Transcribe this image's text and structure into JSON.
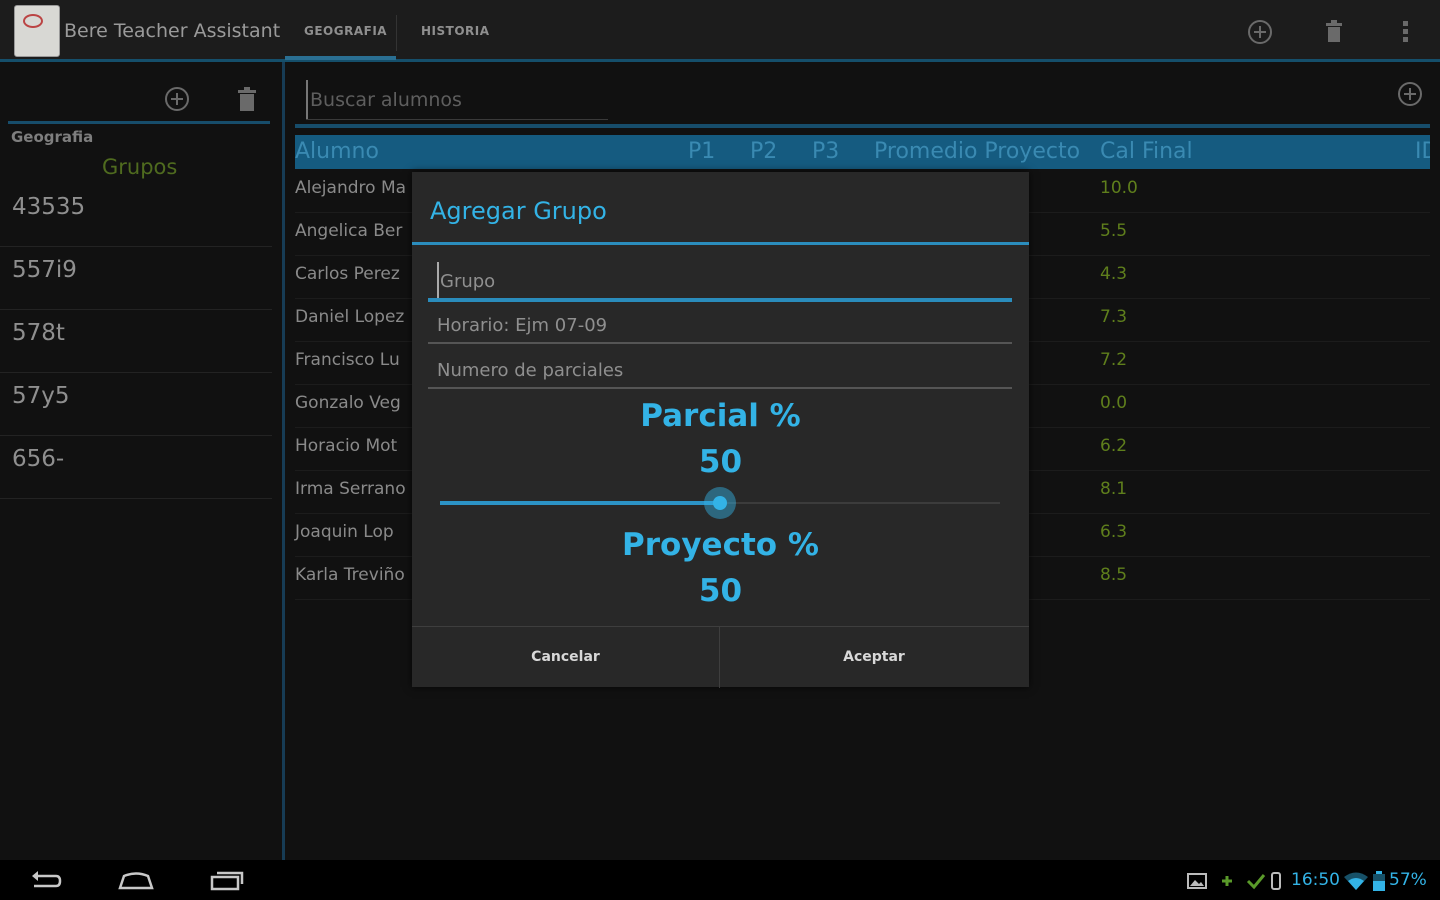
{
  "app": {
    "title": "Bere Teacher Assistant"
  },
  "tabs": [
    {
      "label": "GEOGRAFIA",
      "selected": true
    },
    {
      "label": "HISTORIA",
      "selected": false
    }
  ],
  "action_icons": [
    "add-circle-icon",
    "trash-icon",
    "overflow-menu-icon"
  ],
  "left_pane": {
    "subject": "Geografia",
    "groups_title": "Grupos",
    "groups": [
      "43535",
      "557i9",
      "578t",
      "57y5",
      "656-"
    ]
  },
  "main": {
    "search_placeholder": "Buscar alumnos",
    "table": {
      "headers": [
        "Alumno",
        "P1",
        "P2",
        "P3",
        "Promedio Proyecto",
        "Cal Final",
        "ID"
      ],
      "rows": [
        {
          "name": "Alejandro Ma",
          "cal_final": "10.0"
        },
        {
          "name": "Angelica Ber",
          "cal_final": "5.5"
        },
        {
          "name": "Carlos Perez",
          "cal_final": "4.3"
        },
        {
          "name": "Daniel Lopez",
          "cal_final": "7.3"
        },
        {
          "name": "Francisco Lu",
          "cal_final": "7.2"
        },
        {
          "name": "Gonzalo Veg",
          "cal_final": "0.0"
        },
        {
          "name": "Horacio Mot",
          "cal_final": "6.2"
        },
        {
          "name": "Irma Serrano",
          "cal_final": "8.1"
        },
        {
          "name": "Joaquin Lop",
          "cal_final": "6.3"
        },
        {
          "name": "Karla Treviño",
          "cal_final": "8.5"
        }
      ]
    }
  },
  "dialog": {
    "title": "Agregar Grupo",
    "group_placeholder": "Grupo",
    "schedule_placeholder": "Horario: Ejm 07-09",
    "partials_placeholder": "Numero de parciales",
    "parcial_label": "Parcial %",
    "parcial_value": "50",
    "proyecto_label": "Proyecto %",
    "proyecto_value": "50",
    "slider_fraction": 0.5,
    "cancel_label": "Cancelar",
    "ok_label": "Aceptar"
  },
  "status_bar": {
    "time": "16:50",
    "battery": "57%"
  },
  "colors": {
    "accent": "#33b3e6",
    "grade_green": "#5f7f1c",
    "groups_title": "#4f6b1f",
    "header_bar": "#155b80"
  }
}
